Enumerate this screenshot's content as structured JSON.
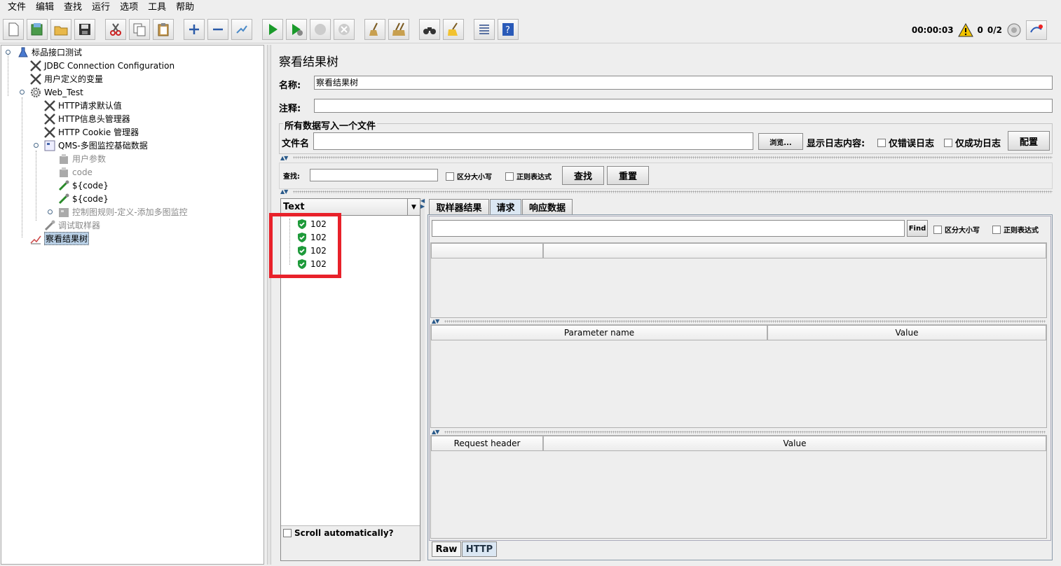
{
  "menu": [
    "文件",
    "编辑",
    "查找",
    "运行",
    "选项",
    "工具",
    "帮助"
  ],
  "status": {
    "elapsed": "00:00:03",
    "warnings": "0",
    "threads": "0/2"
  },
  "tree": {
    "root": "标品接口测试",
    "jdbc": "JDBC Connection Configuration",
    "user_vars": "用户定义的变量",
    "web_test": "Web_Test",
    "http_defaults": "HTTP请求默认值",
    "http_header": "HTTP信息头管理器",
    "http_cookie": "HTTP Cookie 管理器",
    "qms": "QMS-多图监控基础数据",
    "user_params": "用户参数",
    "code": "code",
    "code_var1": "${code}",
    "code_var2": "${code}",
    "control": "控制图规则-定义-添加多图监控",
    "debug": "调试取样器",
    "view_results": "察看结果树"
  },
  "panel": {
    "title": "察看结果树",
    "name_label": "名称:",
    "name_value": "察看结果树",
    "comment_label": "注释:",
    "comment_value": "",
    "file_group": "所有数据写入一个文件",
    "filename_label": "文件名",
    "filename_value": "",
    "browse": "浏览...",
    "log_label": "显示日志内容:",
    "errors_only": "仅错误日志",
    "success_only": "仅成功日志",
    "configure": "配置",
    "search_label": "查找:",
    "search_value": "",
    "case_sensitive": "区分大小写",
    "regex": "正则表达式",
    "find_btn": "查找",
    "reset_btn": "重置"
  },
  "results": {
    "renderer": "Text",
    "items": [
      "102",
      "102",
      "102",
      "102"
    ],
    "scroll_auto": "Scroll automatically?"
  },
  "detail": {
    "tabs": [
      "取样器结果",
      "请求",
      "响应数据"
    ],
    "active_tab": "请求",
    "find_btn": "Find",
    "case_sensitive": "区分大小写",
    "regex": "正则表达式",
    "param_name": "Parameter name",
    "param_value": "Value",
    "req_header": "Request header",
    "req_value": "Value",
    "bottom_tabs": [
      "Raw",
      "HTTP"
    ]
  }
}
